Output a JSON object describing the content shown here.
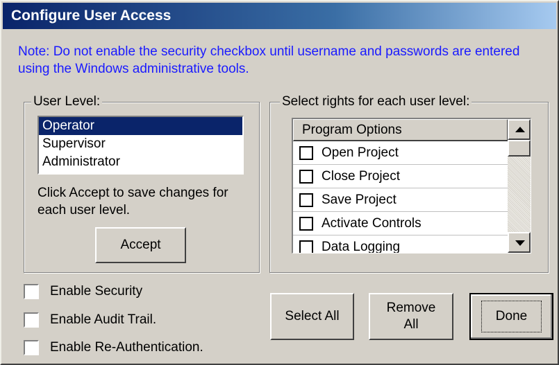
{
  "dialog": {
    "title": "Configure User Access",
    "note": "Note: Do not enable the security checkbox until username and passwords are entered using the Windows administrative tools."
  },
  "user_level": {
    "group_label": "User Level:",
    "items": [
      {
        "label": "Operator",
        "selected": true
      },
      {
        "label": "Supervisor",
        "selected": false
      },
      {
        "label": "Administrator",
        "selected": false
      }
    ],
    "hint": "Click Accept to save changes for each user level.",
    "accept_label": "Accept"
  },
  "rights": {
    "group_label": "Select rights for each user level:",
    "column_header": "Program Options",
    "options": [
      {
        "label": "Open Project",
        "checked": false
      },
      {
        "label": "Close Project",
        "checked": false
      },
      {
        "label": "Save Project",
        "checked": false
      },
      {
        "label": "Activate Controls",
        "checked": false
      },
      {
        "label": "Data Logging",
        "checked": false
      }
    ]
  },
  "security_options": [
    {
      "label": "Enable Security",
      "checked": false
    },
    {
      "label": "Enable Audit Trail.",
      "checked": false
    },
    {
      "label": "Enable Re-Authentication.",
      "checked": false
    }
  ],
  "buttons": {
    "select_all": "Select All",
    "remove_all_line1": "Remove",
    "remove_all_line2": "All",
    "done": "Done"
  },
  "colors": {
    "note_text": "#1a1aff",
    "title_gradient_start": "#0a246a",
    "selection": "#0a246a",
    "face": "#d4d0c8"
  }
}
